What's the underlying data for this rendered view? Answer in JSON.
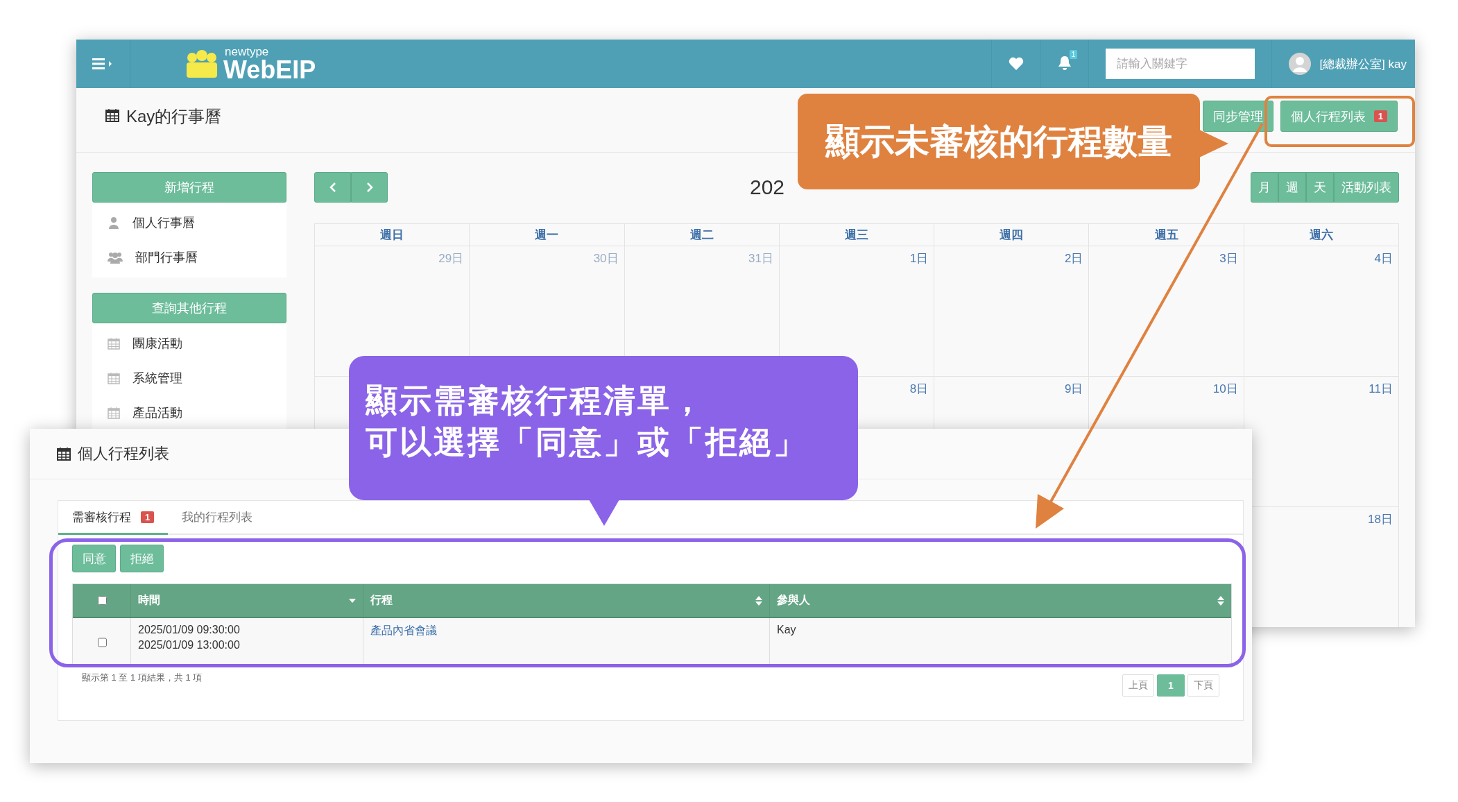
{
  "app": {
    "logo_small": "newtype",
    "logo_large": "WebEIP",
    "notification_badge": "1",
    "search": {
      "placeholder": "請輸入關鍵字"
    },
    "user": "[總裁辦公室] kay"
  },
  "page": {
    "title": "Kay的行事曆",
    "buttons": [
      {
        "label": "同步管理"
      },
      {
        "label": "個人行程列表",
        "badge": "1"
      }
    ]
  },
  "sidebar": {
    "sections": [
      {
        "button": "新增行程",
        "items": [
          {
            "label": "個人行事曆",
            "kind": "person"
          },
          {
            "label": "部門行事曆",
            "kind": "group"
          }
        ]
      },
      {
        "button": "查詢其他行程",
        "items": [
          {
            "label": "團康活動",
            "kind": "calendar"
          },
          {
            "label": "系統管理",
            "kind": "calendar"
          },
          {
            "label": "產品活動",
            "kind": "calendar"
          }
        ]
      }
    ]
  },
  "calendar": {
    "title": "202",
    "views": [
      "月",
      "週",
      "天",
      "活動列表"
    ],
    "weekdays": [
      "週日",
      "週一",
      "週二",
      "週三",
      "週四",
      "週五",
      "週六"
    ],
    "weeks": [
      [
        {
          "label": "29日",
          "other_month": true
        },
        {
          "label": "30日",
          "other_month": true
        },
        {
          "label": "31日",
          "other_month": true
        },
        {
          "label": "1日",
          "other_month": false
        },
        {
          "label": "2日",
          "other_month": false
        },
        {
          "label": "3日",
          "other_month": false
        },
        {
          "label": "4日",
          "other_month": false
        }
      ],
      [
        {
          "label": "8日",
          "other_month": false
        },
        {
          "label": "9日",
          "other_month": false
        },
        {
          "label": "10日",
          "other_month": false
        },
        {
          "label": "11日",
          "other_month": false
        }
      ],
      [
        {
          "label": "18日",
          "other_month": false
        }
      ]
    ]
  },
  "dialog": {
    "title": "個人行程列表",
    "tabs": [
      {
        "label": "需審核行程",
        "badge": "1",
        "selected": true
      },
      {
        "label": "我的行程列表",
        "selected": false
      }
    ],
    "actions": [
      "同意",
      "拒絕"
    ],
    "select_all": {
      "checked": false
    },
    "columns": [
      {
        "label": "時間",
        "sorted": true
      },
      {
        "label": "行程",
        "sorted": false
      },
      {
        "label": "參與人",
        "sorted": false
      }
    ],
    "rows": [
      {
        "checked": false,
        "time": [
          "2025/01/09 09:30:00",
          "2025/01/09 13:00:00"
        ],
        "event": "產品內省會議",
        "participant": "Kay"
      }
    ],
    "info": "顯示第 1 至 1 項結果，共 1 項",
    "pagination": [
      {
        "label": "上頁",
        "selected": false
      },
      {
        "label": "1",
        "selected": true
      },
      {
        "label": "下頁",
        "selected": false
      }
    ]
  },
  "callouts": [
    {
      "lines": [
        "顯示未審核的行程數量"
      ],
      "color": "#df8240"
    },
    {
      "lines": [
        "顯示需審核行程清單，",
        "可以選擇「同意」或「拒絕」"
      ],
      "color": "#8b63e8"
    }
  ]
}
